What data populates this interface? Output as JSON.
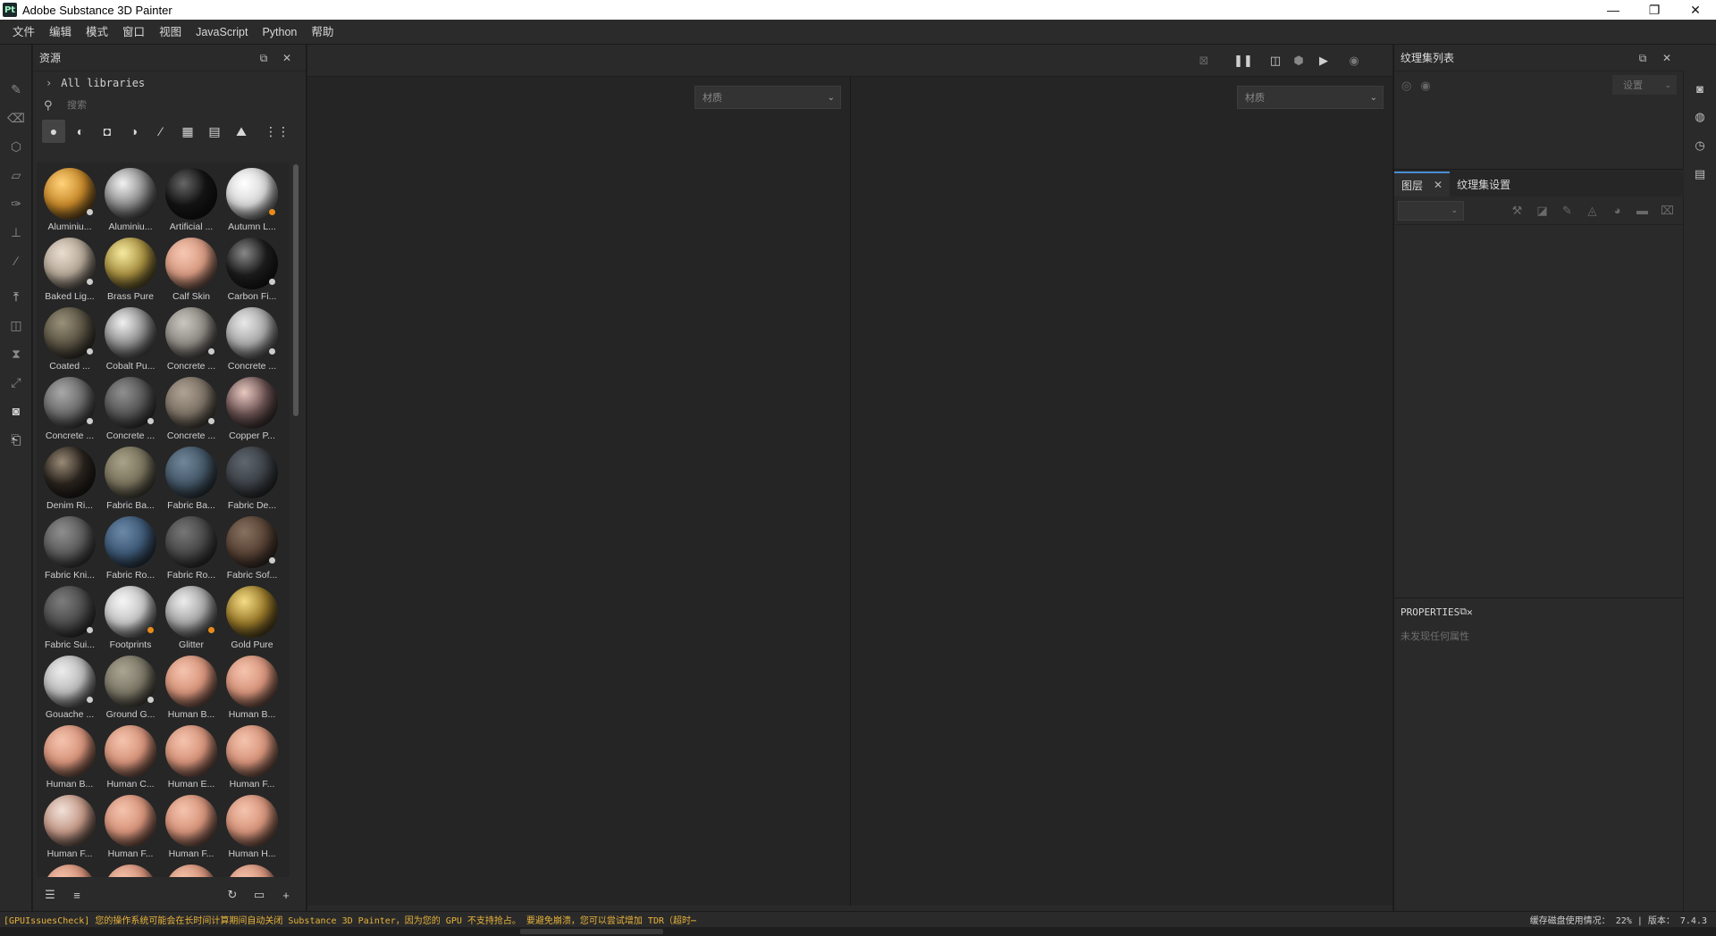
{
  "app": {
    "logo": "Pt",
    "title": "Adobe Substance 3D Painter"
  },
  "window_controls": {
    "minimize": "—",
    "restore": "❐",
    "close": "✕"
  },
  "menu": [
    "文件",
    "编辑",
    "模式",
    "窗口",
    "视图",
    "JavaScript",
    "Python",
    "帮助"
  ],
  "assets": {
    "title": "资源",
    "library": "All libraries",
    "search_placeholder": "搜索",
    "materials": [
      {
        "label": "Aluminiu...",
        "color": "#c98a2a",
        "hi": "#ffd27a",
        "badge": "#ccc"
      },
      {
        "label": "Aluminiu...",
        "color": "#8c8c8c",
        "hi": "#f2f2f2",
        "badge": ""
      },
      {
        "label": "Artificial ...",
        "color": "#141414",
        "hi": "#666",
        "badge": ""
      },
      {
        "label": "Autumn L...",
        "color": "#d8d8d8",
        "hi": "#ffffff",
        "badge": "#e88a1a"
      },
      {
        "label": "Baked Lig...",
        "color": "#b6a898",
        "hi": "#e8ddd0",
        "badge": "#ccc"
      },
      {
        "label": "Brass Pure",
        "color": "#a89040",
        "hi": "#f6eaa0",
        "badge": ""
      },
      {
        "label": "Calf Skin",
        "color": "#d99b82",
        "hi": "#f6c7b3",
        "badge": ""
      },
      {
        "label": "Carbon Fi...",
        "color": "#1d1d1d",
        "hi": "#888",
        "badge": "#ccc"
      },
      {
        "label": "Coated ...",
        "color": "#5b5444",
        "hi": "#9a917a",
        "badge": "#ccc"
      },
      {
        "label": "Cobalt Pu...",
        "color": "#8f8f8f",
        "hi": "#f0f0f0",
        "badge": ""
      },
      {
        "label": "Concrete ...",
        "color": "#8e8a84",
        "hi": "#c9c5bf",
        "badge": "#ccc"
      },
      {
        "label": "Concrete ...",
        "color": "#a9a9a9",
        "hi": "#e8e8e8",
        "badge": "#ccc"
      },
      {
        "label": "Concrete ...",
        "color": "#6c6c6c",
        "hi": "#a8a8a8",
        "badge": "#ccc"
      },
      {
        "label": "Concrete ...",
        "color": "#575757",
        "hi": "#8f8f8f",
        "badge": "#ccc"
      },
      {
        "label": "Concrete ...",
        "color": "#7e7366",
        "hi": "#aea294",
        "badge": "#ccc"
      },
      {
        "label": "Copper P...",
        "color": "#6b5252",
        "hi": "#e8c8c0",
        "badge": ""
      },
      {
        "label": "Denim Ri...",
        "color": "#2a241e",
        "hi": "#9a8a76",
        "badge": ""
      },
      {
        "label": "Fabric Ba...",
        "color": "#7a745e",
        "hi": "#a8a288",
        "badge": ""
      },
      {
        "label": "Fabric Ba...",
        "color": "#45596a",
        "hi": "#708699",
        "badge": ""
      },
      {
        "label": "Fabric De...",
        "color": "#3d4248",
        "hi": "#5f666e",
        "badge": ""
      },
      {
        "label": "Fabric Kni...",
        "color": "#5d5d5d",
        "hi": "#8e8e8e",
        "badge": ""
      },
      {
        "label": "Fabric Ro...",
        "color": "#3e5a78",
        "hi": "#6c89a8",
        "badge": ""
      },
      {
        "label": "Fabric Ro...",
        "color": "#4a4a4a",
        "hi": "#767676",
        "badge": ""
      },
      {
        "label": "Fabric Sof...",
        "color": "#5a4436",
        "hi": "#86705f",
        "badge": "#ccc"
      },
      {
        "label": "Fabric Sui...",
        "color": "#4e4e4e",
        "hi": "#7c7c7c",
        "badge": "#ccc"
      },
      {
        "label": "Footprints",
        "color": "#c6c6c6",
        "hi": "#f5f5f5",
        "badge": "#e88a1a"
      },
      {
        "label": "Glitter",
        "color": "#a8a8a8",
        "hi": "#ececec",
        "badge": "#e88a1a"
      },
      {
        "label": "Gold Pure",
        "color": "#9a7a2a",
        "hi": "#f5dc84",
        "badge": ""
      },
      {
        "label": "Gouache ...",
        "color": "#bcbcbc",
        "hi": "#ececec",
        "badge": "#ccc"
      },
      {
        "label": "Ground G...",
        "color": "#7d7867",
        "hi": "#aaa593",
        "badge": "#ccc"
      },
      {
        "label": "Human B...",
        "color": "#d9957c",
        "hi": "#f4c3ad",
        "badge": ""
      },
      {
        "label": "Human B...",
        "color": "#d9957c",
        "hi": "#f4c3ad",
        "badge": ""
      },
      {
        "label": "Human B...",
        "color": "#d9957c",
        "hi": "#f4c3ad",
        "badge": ""
      },
      {
        "label": "Human C...",
        "color": "#d9957c",
        "hi": "#f4c3ad",
        "badge": ""
      },
      {
        "label": "Human E...",
        "color": "#d9957c",
        "hi": "#f4c3ad",
        "badge": ""
      },
      {
        "label": "Human F...",
        "color": "#d9957c",
        "hi": "#f4c3ad",
        "badge": ""
      },
      {
        "label": "Human F...",
        "color": "#c69a88",
        "hi": "#f0e0d8",
        "badge": ""
      },
      {
        "label": "Human F...",
        "color": "#d9957c",
        "hi": "#f4c3ad",
        "badge": ""
      },
      {
        "label": "Human F...",
        "color": "#d9957c",
        "hi": "#f4c3ad",
        "badge": ""
      },
      {
        "label": "Human H...",
        "color": "#d9957c",
        "hi": "#f4c3ad",
        "badge": ""
      },
      {
        "label": "",
        "color": "#d9957c",
        "hi": "#f4c3ad",
        "badge": ""
      },
      {
        "label": "",
        "color": "#d9957c",
        "hi": "#f4c3ad",
        "badge": ""
      },
      {
        "label": "",
        "color": "#d9957c",
        "hi": "#f4c3ad",
        "badge": ""
      },
      {
        "label": "",
        "color": "#d9957c",
        "hi": "#f4c3ad",
        "badge": ""
      }
    ]
  },
  "viewport": {
    "left_select": "材质",
    "right_select": "材质"
  },
  "texture_set_list": {
    "title": "纹理集列表",
    "settings": "设置"
  },
  "layers": {
    "tab_layers": "图层",
    "tab_texture_settings": "纹理集设置"
  },
  "properties": {
    "title": "PROPERTIES",
    "empty": "未发现任何属性"
  },
  "status": {
    "message": "[GPUIssuesCheck] 您的操作系统可能会在长时间计算期间自动关闭 Substance 3D Painter，因为您的 GPU 不支持抢占。 要避免崩溃，您可以尝试增加 TDR（超时⋯",
    "disk_label": "缓存磁盘使用情况：",
    "disk_value": "22%",
    "version_label": "版本：",
    "version_value": "7.4.3",
    "warn_color": "#e8b33a"
  }
}
